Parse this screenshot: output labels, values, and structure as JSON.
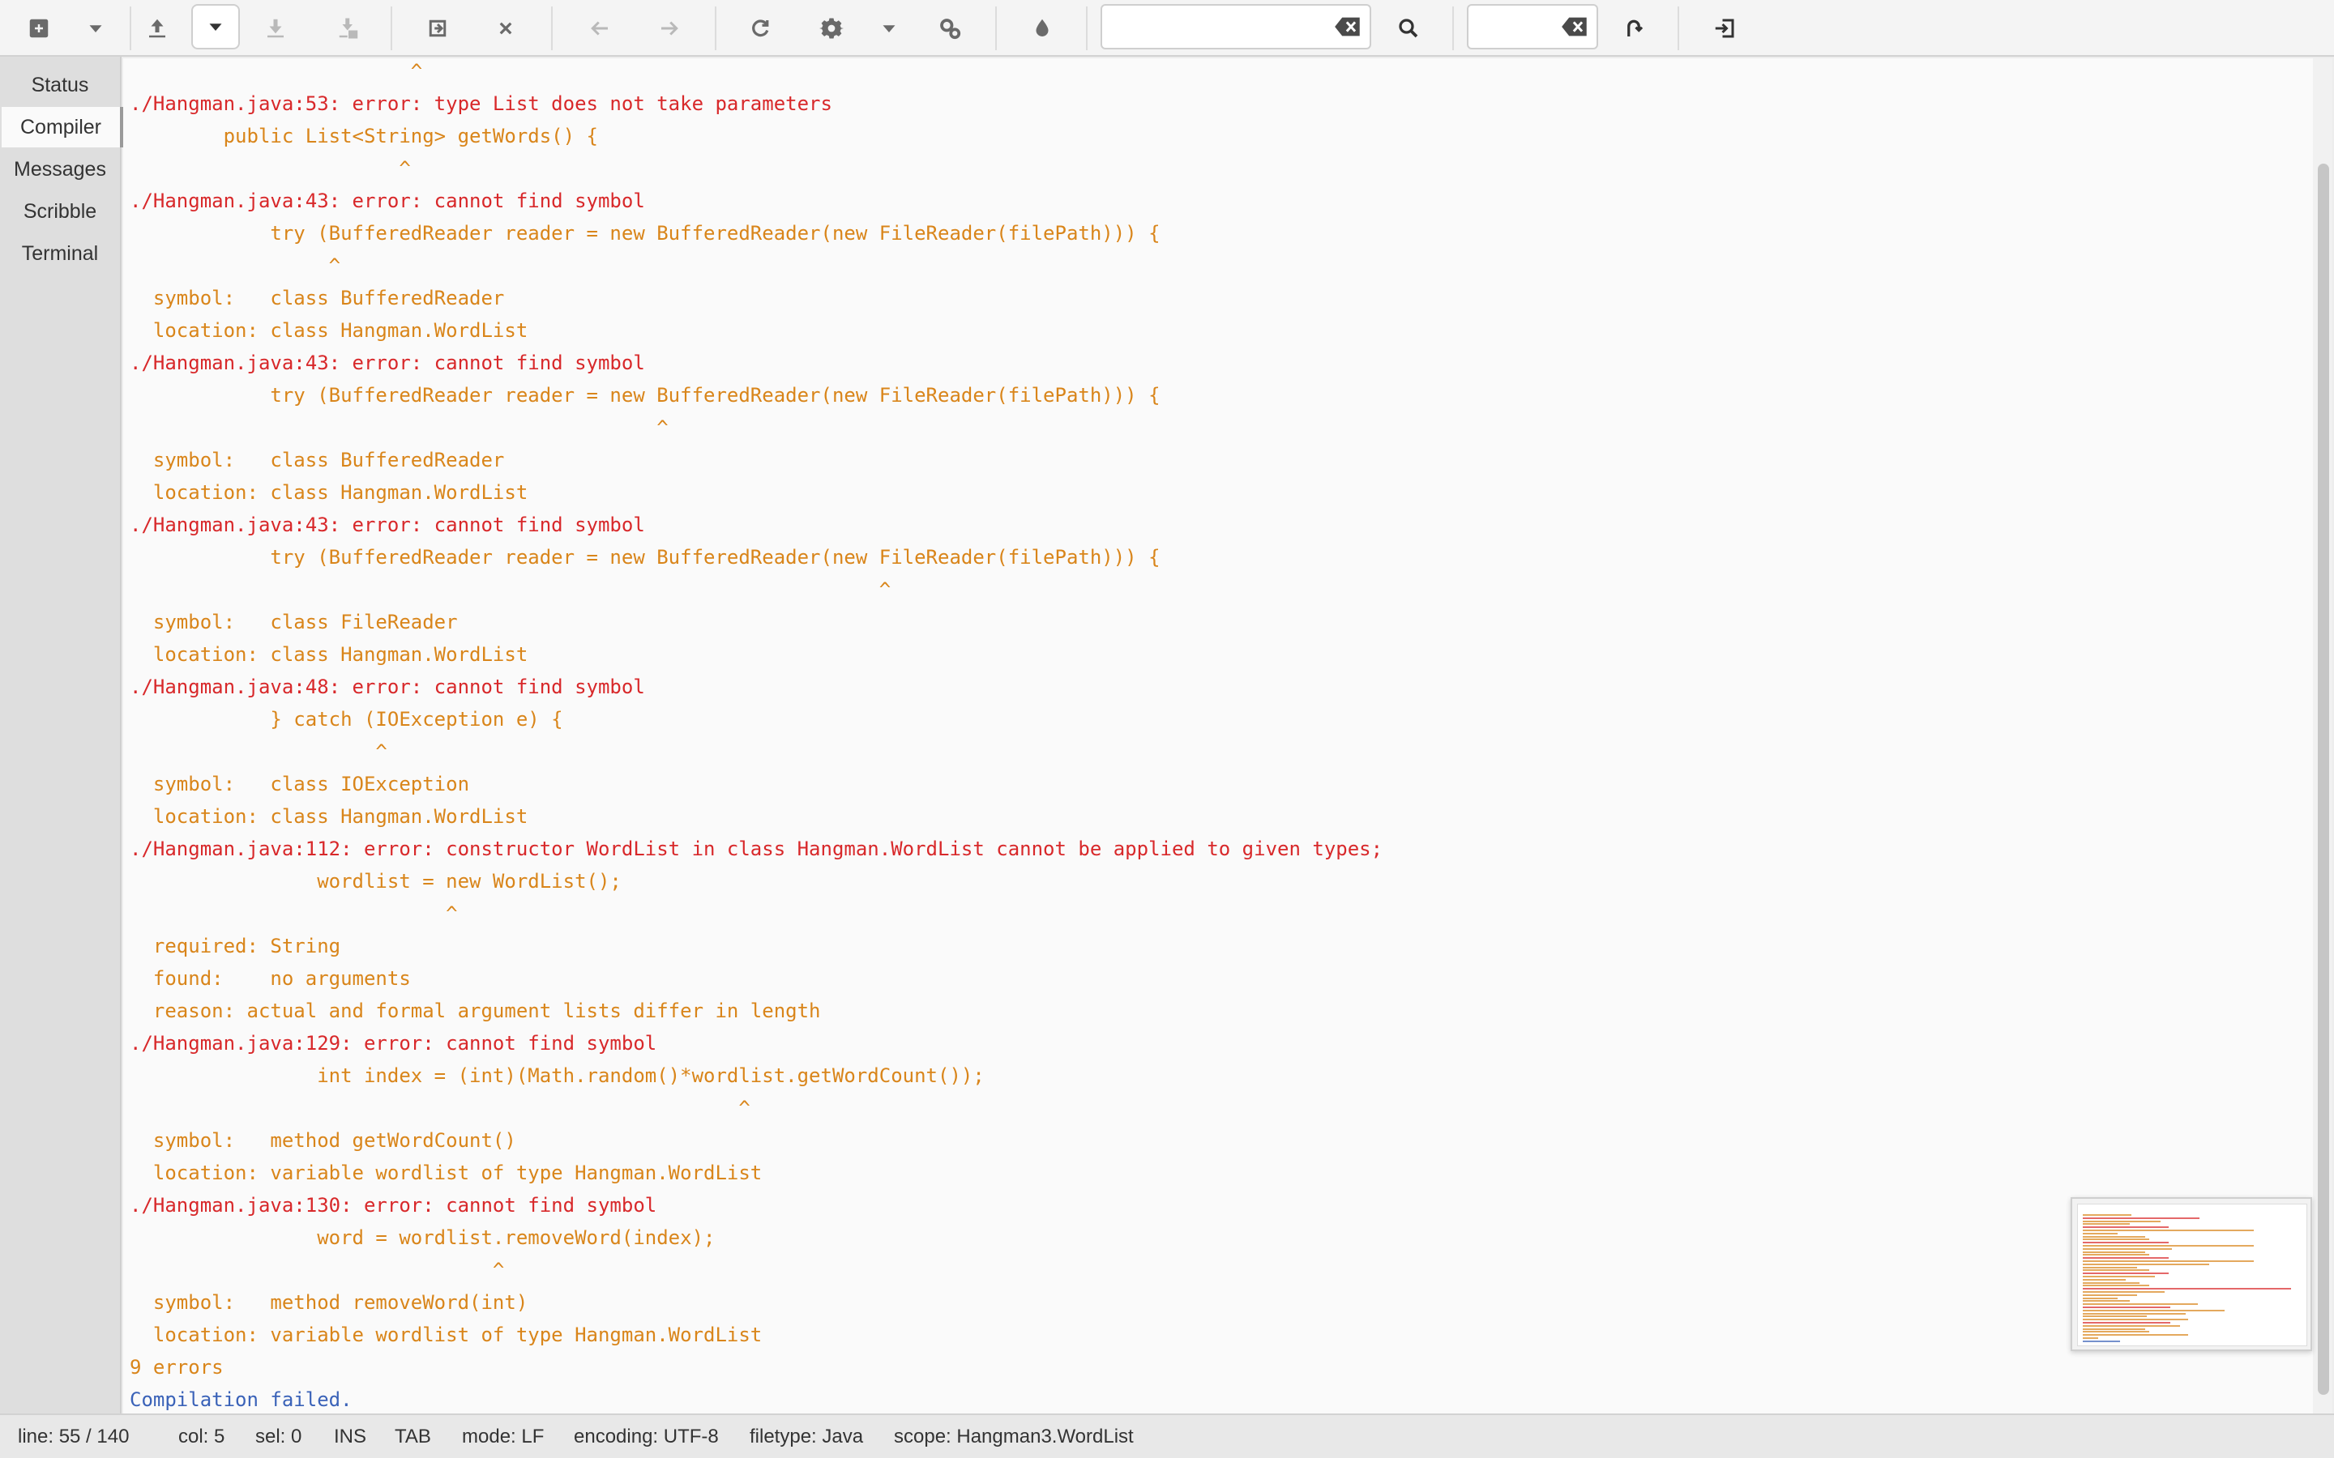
{
  "toolbar": {
    "icons": [
      "new-file-icon",
      "dropdown-arrow-icon",
      "upload-icon",
      "dropdown-arrow-icon",
      "download-icon",
      "download-disabled-icon",
      "revert-icon",
      "close-icon",
      "back-arrow-icon",
      "forward-arrow-icon",
      "reload-icon",
      "gear-icon",
      "dropdown-arrow-icon",
      "build-icon",
      "color-drop-icon",
      "search-icon",
      "jump-icon",
      "quit-icon"
    ],
    "search_value": "",
    "goto_value": ""
  },
  "sidebar": {
    "tabs": [
      {
        "label": "Status"
      },
      {
        "label": "Compiler"
      },
      {
        "label": "Messages"
      },
      {
        "label": "Scribble"
      },
      {
        "label": "Terminal"
      }
    ],
    "active": "Compiler"
  },
  "output": {
    "lines": [
      {
        "text": "                        ^",
        "kind": "code"
      },
      {
        "text": "./Hangman.java:53: error: type List does not take parameters",
        "kind": "error"
      },
      {
        "text": "        public List<String> getWords() {",
        "kind": "code"
      },
      {
        "text": "                       ^",
        "kind": "code"
      },
      {
        "text": "./Hangman.java:43: error: cannot find symbol",
        "kind": "error"
      },
      {
        "text": "            try (BufferedReader reader = new BufferedReader(new FileReader(filePath))) {",
        "kind": "code"
      },
      {
        "text": "                 ^",
        "kind": "code"
      },
      {
        "text": "  symbol:   class BufferedReader",
        "kind": "code"
      },
      {
        "text": "  location: class Hangman.WordList",
        "kind": "code"
      },
      {
        "text": "./Hangman.java:43: error: cannot find symbol",
        "kind": "error"
      },
      {
        "text": "            try (BufferedReader reader = new BufferedReader(new FileReader(filePath))) {",
        "kind": "code"
      },
      {
        "text": "                                             ^",
        "kind": "code"
      },
      {
        "text": "  symbol:   class BufferedReader",
        "kind": "code"
      },
      {
        "text": "  location: class Hangman.WordList",
        "kind": "code"
      },
      {
        "text": "./Hangman.java:43: error: cannot find symbol",
        "kind": "error"
      },
      {
        "text": "            try (BufferedReader reader = new BufferedReader(new FileReader(filePath))) {",
        "kind": "code"
      },
      {
        "text": "                                                                ^",
        "kind": "code"
      },
      {
        "text": "  symbol:   class FileReader",
        "kind": "code"
      },
      {
        "text": "  location: class Hangman.WordList",
        "kind": "code"
      },
      {
        "text": "./Hangman.java:48: error: cannot find symbol",
        "kind": "error"
      },
      {
        "text": "            } catch (IOException e) {",
        "kind": "code"
      },
      {
        "text": "                     ^",
        "kind": "code"
      },
      {
        "text": "  symbol:   class IOException",
        "kind": "code"
      },
      {
        "text": "  location: class Hangman.WordList",
        "kind": "code"
      },
      {
        "text": "./Hangman.java:112: error: constructor WordList in class Hangman.WordList cannot be applied to given types;",
        "kind": "error"
      },
      {
        "text": "                wordlist = new WordList();",
        "kind": "code"
      },
      {
        "text": "                           ^",
        "kind": "code"
      },
      {
        "text": "  required: String",
        "kind": "code"
      },
      {
        "text": "  found:    no arguments",
        "kind": "code"
      },
      {
        "text": "  reason: actual and formal argument lists differ in length",
        "kind": "code"
      },
      {
        "text": "./Hangman.java:129: error: cannot find symbol",
        "kind": "error"
      },
      {
        "text": "                int index = (int)(Math.random()*wordlist.getWordCount());",
        "kind": "code"
      },
      {
        "text": "                                                    ^",
        "kind": "code"
      },
      {
        "text": "  symbol:   method getWordCount()",
        "kind": "code"
      },
      {
        "text": "  location: variable wordlist of type Hangman.WordList",
        "kind": "code"
      },
      {
        "text": "./Hangman.java:130: error: cannot find symbol",
        "kind": "error"
      },
      {
        "text": "                word = wordlist.removeWord(index);",
        "kind": "code"
      },
      {
        "text": "                               ^",
        "kind": "code"
      },
      {
        "text": "  symbol:   method removeWord(int)",
        "kind": "code"
      },
      {
        "text": "  location: variable wordlist of type Hangman.WordList",
        "kind": "code"
      },
      {
        "text": "9 errors",
        "kind": "code"
      },
      {
        "text": "Compilation failed.",
        "kind": "fail"
      }
    ]
  },
  "statusbar": {
    "line": "line: 55 / 140",
    "col": "col: 5",
    "sel": "sel: 0",
    "ins": "INS",
    "tab": "TAB",
    "mode": "mode: LF",
    "encoding": "encoding: UTF-8",
    "filetype": "filetype: Java",
    "scope": "scope: Hangman3.WordList"
  },
  "colors": {
    "error": "#d8282a",
    "code": "#d9851a",
    "fail": "#3a62b8"
  }
}
